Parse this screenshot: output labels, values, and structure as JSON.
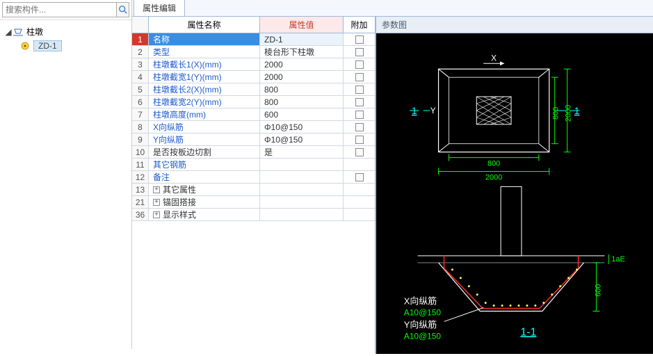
{
  "search": {
    "placeholder": "搜索构件..."
  },
  "tree": {
    "root_label": "柱墩",
    "child_label": "ZD-1"
  },
  "tabs": {
    "prop_editor": "属性编辑"
  },
  "table": {
    "headers": {
      "name": "属性名称",
      "value": "属性值",
      "add": "附加"
    },
    "rows": [
      {
        "n": "1",
        "name": "名称",
        "value": "ZD-1",
        "chk": true,
        "plain": false,
        "selected": true
      },
      {
        "n": "2",
        "name": "类型",
        "value": "棱台形下柱墩",
        "chk": true,
        "plain": false
      },
      {
        "n": "3",
        "name": "柱墩截长1(X)(mm)",
        "value": "2000",
        "chk": true,
        "plain": false
      },
      {
        "n": "4",
        "name": "柱墩截宽1(Y)(mm)",
        "value": "2000",
        "chk": true,
        "plain": false
      },
      {
        "n": "5",
        "name": "柱墩截长2(X)(mm)",
        "value": "800",
        "chk": true,
        "plain": false
      },
      {
        "n": "6",
        "name": "柱墩截宽2(Y)(mm)",
        "value": "800",
        "chk": true,
        "plain": false
      },
      {
        "n": "7",
        "name": "柱墩高度(mm)",
        "value": "600",
        "chk": true,
        "plain": false
      },
      {
        "n": "8",
        "name": "X向纵筋",
        "value": "Φ10@150",
        "chk": true,
        "plain": false
      },
      {
        "n": "9",
        "name": "Y向纵筋",
        "value": "Φ10@150",
        "chk": true,
        "plain": false
      },
      {
        "n": "10",
        "name": "是否按板边切割",
        "value": "是",
        "chk": true,
        "plain": true
      },
      {
        "n": "11",
        "name": "其它钢筋",
        "value": "",
        "chk": false,
        "plain": false
      },
      {
        "n": "12",
        "name": "备注",
        "value": "",
        "chk": true,
        "plain": false
      },
      {
        "n": "13",
        "name": "其它属性",
        "value": "",
        "chk": false,
        "plain": true,
        "expandable": true
      },
      {
        "n": "21",
        "name": "锚固搭接",
        "value": "",
        "chk": false,
        "plain": true,
        "expandable": true
      },
      {
        "n": "36",
        "name": "显示样式",
        "value": "",
        "chk": false,
        "plain": true,
        "expandable": true
      }
    ]
  },
  "diagram": {
    "title": "参数图",
    "top": {
      "x_label": "X",
      "y_label": "Y",
      "inner_w": "800",
      "inner_h": "800",
      "outer_w": "2000",
      "outer_h": "2000",
      "sec_left": "1",
      "sec_right": "1"
    },
    "bottom": {
      "x_rebar_label": "X向纵筋",
      "x_rebar_val": "A10@150",
      "y_rebar_label": "Y向纵筋",
      "y_rebar_val": "A10@150",
      "height": "600",
      "lae": "1aE",
      "section": "1-1"
    }
  }
}
